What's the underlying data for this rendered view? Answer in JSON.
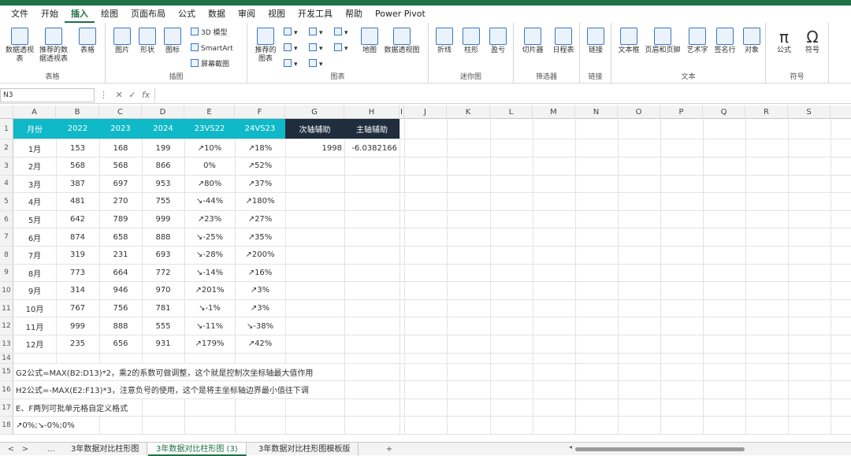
{
  "menu": [
    "文件",
    "开始",
    "插入",
    "绘图",
    "页面布局",
    "公式",
    "数据",
    "审阅",
    "视图",
    "开发工具",
    "帮助",
    "Power Pivot"
  ],
  "ribbon": {
    "groups": [
      {
        "label": "表格"
      },
      {
        "label": "插图"
      },
      {
        "label": "图表"
      },
      {
        "label": "迷你图"
      },
      {
        "label": "筛选器"
      },
      {
        "label": "链接"
      },
      {
        "label": "文本"
      },
      {
        "label": "符号"
      }
    ],
    "buttons": {
      "pivot": "数据透视表",
      "rec_pivot": "推荐的数据透视表",
      "table": "表格",
      "pictures": "图片",
      "shapes": "形状",
      "icons": "图标",
      "model3d": "3D 模型",
      "smartart": "SmartArt",
      "screenshot": "屏幕截图",
      "rec_charts": "推荐的图表",
      "maps": "地图",
      "pivotchart": "数据透视图",
      "line": "折线",
      "column": "柱形",
      "winloss": "盈亏",
      "slicer": "切片器",
      "timeline": "日程表",
      "link": "链接",
      "textbox": "文本框",
      "headerfooter": "页眉和页脚",
      "wordart": "艺术字",
      "signature": "签名行",
      "object": "对象",
      "equation": "公式",
      "symbol": "符号"
    }
  },
  "formula_bar": {
    "name_box": "N3",
    "fx": "fx",
    "value": ""
  },
  "columns": [
    "A",
    "B",
    "C",
    "D",
    "E",
    "F",
    "G",
    "H",
    "I",
    "J",
    "K",
    "L",
    "M",
    "N",
    "O",
    "P",
    "Q",
    "R",
    "S"
  ],
  "table": {
    "headers": [
      "月份",
      "2022",
      "2023",
      "2024",
      "23VS22",
      "24VS23",
      "次轴辅助",
      "主轴辅助"
    ],
    "rows": [
      [
        "1月",
        "153",
        "168",
        "199",
        "↗10%",
        "↗18%",
        "1998",
        "-6.0382166"
      ],
      [
        "2月",
        "568",
        "568",
        "866",
        "0%",
        "↗52%",
        "",
        ""
      ],
      [
        "3月",
        "387",
        "697",
        "953",
        "↗80%",
        "↗37%",
        "",
        ""
      ],
      [
        "4月",
        "481",
        "270",
        "755",
        "↘-44%",
        "↗180%",
        "",
        ""
      ],
      [
        "5月",
        "642",
        "789",
        "999",
        "↗23%",
        "↗27%",
        "",
        ""
      ],
      [
        "6月",
        "874",
        "658",
        "888",
        "↘-25%",
        "↗35%",
        "",
        ""
      ],
      [
        "7月",
        "319",
        "231",
        "693",
        "↘-28%",
        "↗200%",
        "",
        ""
      ],
      [
        "8月",
        "773",
        "664",
        "772",
        "↘-14%",
        "↗16%",
        "",
        ""
      ],
      [
        "9月",
        "314",
        "946",
        "970",
        "↗201%",
        "↗3%",
        "",
        ""
      ],
      [
        "10月",
        "767",
        "756",
        "781",
        "↘-1%",
        "↗3%",
        "",
        ""
      ],
      [
        "11月",
        "999",
        "888",
        "555",
        "↘-11%",
        "↘-38%",
        "",
        ""
      ],
      [
        "12月",
        "235",
        "656",
        "931",
        "↗179%",
        "↗42%",
        "",
        ""
      ]
    ]
  },
  "notes": {
    "r15": "G2公式=MAX(B2:D13)*2，乘2的系数可做调整，这个就是控制次坐标轴最大值作用",
    "r16": "H2公式=-MAX(E2:F13)*3，注意负号的使用，这个是将主坐标轴边界最小值往下调",
    "r17": "E、F两列可批单元格自定义格式",
    "r18": "↗0%;↘-0%;0%"
  },
  "row_numbers": [
    "1",
    "2",
    "3",
    "4",
    "5",
    "6",
    "7",
    "8",
    "9",
    "10",
    "11",
    "12",
    "13",
    "14",
    "15",
    "16",
    "17",
    "18"
  ],
  "sheet_tabs": [
    "3年数据对比柱形图",
    "3年数据对比柱形图 (3)",
    "3年数据对比柱形图模板版"
  ],
  "tab_nav": {
    "prev": "<",
    "next": ">",
    "more": "...",
    "add": "+"
  },
  "colors": {
    "header_teal": "#0fb9c8",
    "header_dark": "#1f2d3d",
    "excel_green": "#1e7145"
  }
}
